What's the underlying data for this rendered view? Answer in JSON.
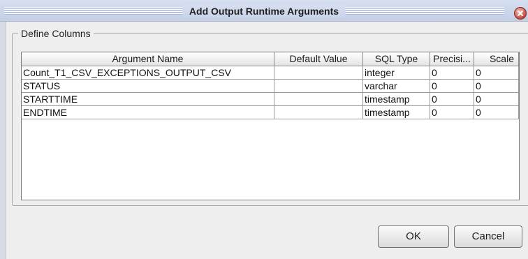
{
  "dialog": {
    "title": "Add Output Runtime Arguments",
    "colors": {
      "title_bar": "#c3cee6",
      "close_button": "#c64b3a",
      "background": "#eeeeee"
    }
  },
  "define_columns": {
    "legend": "Define Columns",
    "headers": [
      "Argument Name",
      "Default Value",
      "SQL Type",
      "Precisi...",
      "Scale"
    ],
    "rows": [
      [
        "Count_T1_CSV_EXCEPTIONS_OUTPUT_CSV",
        "",
        "integer",
        "0",
        "0"
      ],
      [
        "STATUS",
        "",
        "varchar",
        "0",
        "0"
      ],
      [
        "STARTTIME",
        "",
        "timestamp",
        "0",
        "0"
      ],
      [
        "ENDTIME",
        "",
        "timestamp",
        "0",
        "0"
      ]
    ]
  },
  "buttons": {
    "ok": "OK",
    "cancel": "Cancel"
  },
  "icons": {
    "close": "close-icon"
  }
}
